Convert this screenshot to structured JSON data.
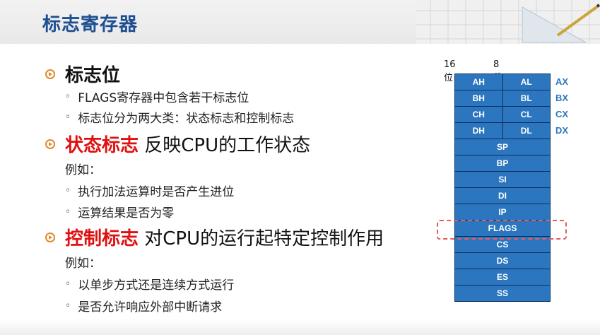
{
  "slide": {
    "title": "标志寄存器",
    "sections": [
      {
        "heading": "标志位",
        "heading_red": "",
        "heading_rest": ""
      },
      {
        "heading": "",
        "heading_red": "状态标志",
        "heading_rest": " 反映CPU的工作状态"
      },
      {
        "heading": "",
        "heading_red": "控制标志",
        "heading_rest": " 对CPU的运行起特定控制作用"
      }
    ],
    "flag_bullets": [
      "FLAGS寄存器中包含若干标志位",
      "标志位分为两大类：状态标志和控制标志"
    ],
    "status_example_label": "例如：",
    "status_bullets": [
      "执行加法运算时是否产生进位",
      "运算结果是否为零"
    ],
    "control_example_label": "例如：",
    "control_bullets": [
      "以单步方式还是连续方式运行",
      "是否允许响应外部中断请求"
    ],
    "bullet_glyph": "◦"
  },
  "registers": {
    "label_16": "16位",
    "label_8": "8位",
    "split_rows": [
      {
        "high": "AH",
        "low": "AL",
        "name": "AX"
      },
      {
        "high": "BH",
        "low": "BL",
        "name": "BX"
      },
      {
        "high": "CH",
        "low": "CL",
        "name": "CX"
      },
      {
        "high": "DH",
        "low": "DL",
        "name": "DX"
      }
    ],
    "full_rows": [
      "SP",
      "BP",
      "SI",
      "DI",
      "IP",
      "FLAGS",
      "CS",
      "DS",
      "ES",
      "SS"
    ],
    "highlighted": "FLAGS"
  },
  "colors": {
    "title": "#1d4f91",
    "accent_red": "#e01010",
    "register_fill": "#2c76bf",
    "bullet_orange": "#e08a2c",
    "highlight_dash": "#e06060"
  }
}
